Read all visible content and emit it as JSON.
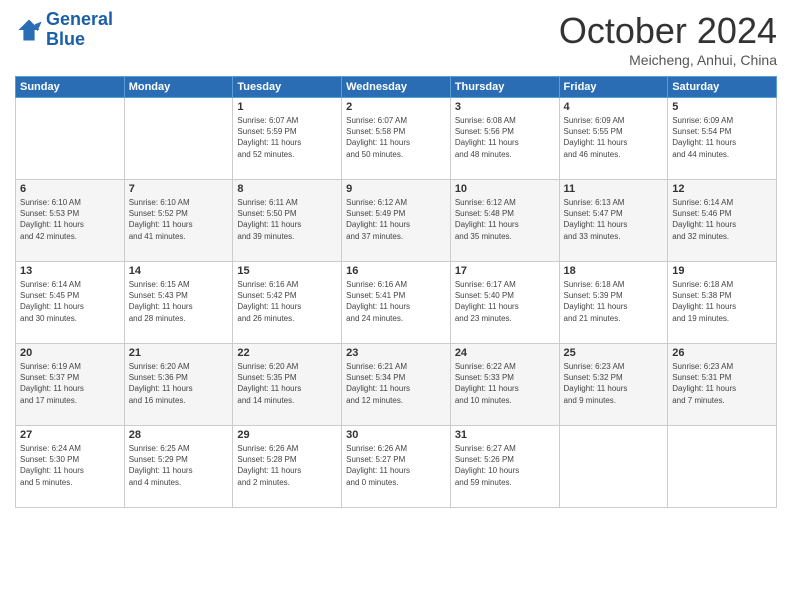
{
  "logo": {
    "line1": "General",
    "line2": "Blue"
  },
  "header": {
    "month": "October 2024",
    "location": "Meicheng, Anhui, China"
  },
  "weekdays": [
    "Sunday",
    "Monday",
    "Tuesday",
    "Wednesday",
    "Thursday",
    "Friday",
    "Saturday"
  ],
  "weeks": [
    [
      {
        "day": "",
        "info": ""
      },
      {
        "day": "",
        "info": ""
      },
      {
        "day": "1",
        "info": "Sunrise: 6:07 AM\nSunset: 5:59 PM\nDaylight: 11 hours\nand 52 minutes."
      },
      {
        "day": "2",
        "info": "Sunrise: 6:07 AM\nSunset: 5:58 PM\nDaylight: 11 hours\nand 50 minutes."
      },
      {
        "day": "3",
        "info": "Sunrise: 6:08 AM\nSunset: 5:56 PM\nDaylight: 11 hours\nand 48 minutes."
      },
      {
        "day": "4",
        "info": "Sunrise: 6:09 AM\nSunset: 5:55 PM\nDaylight: 11 hours\nand 46 minutes."
      },
      {
        "day": "5",
        "info": "Sunrise: 6:09 AM\nSunset: 5:54 PM\nDaylight: 11 hours\nand 44 minutes."
      }
    ],
    [
      {
        "day": "6",
        "info": "Sunrise: 6:10 AM\nSunset: 5:53 PM\nDaylight: 11 hours\nand 42 minutes."
      },
      {
        "day": "7",
        "info": "Sunrise: 6:10 AM\nSunset: 5:52 PM\nDaylight: 11 hours\nand 41 minutes."
      },
      {
        "day": "8",
        "info": "Sunrise: 6:11 AM\nSunset: 5:50 PM\nDaylight: 11 hours\nand 39 minutes."
      },
      {
        "day": "9",
        "info": "Sunrise: 6:12 AM\nSunset: 5:49 PM\nDaylight: 11 hours\nand 37 minutes."
      },
      {
        "day": "10",
        "info": "Sunrise: 6:12 AM\nSunset: 5:48 PM\nDaylight: 11 hours\nand 35 minutes."
      },
      {
        "day": "11",
        "info": "Sunrise: 6:13 AM\nSunset: 5:47 PM\nDaylight: 11 hours\nand 33 minutes."
      },
      {
        "day": "12",
        "info": "Sunrise: 6:14 AM\nSunset: 5:46 PM\nDaylight: 11 hours\nand 32 minutes."
      }
    ],
    [
      {
        "day": "13",
        "info": "Sunrise: 6:14 AM\nSunset: 5:45 PM\nDaylight: 11 hours\nand 30 minutes."
      },
      {
        "day": "14",
        "info": "Sunrise: 6:15 AM\nSunset: 5:43 PM\nDaylight: 11 hours\nand 28 minutes."
      },
      {
        "day": "15",
        "info": "Sunrise: 6:16 AM\nSunset: 5:42 PM\nDaylight: 11 hours\nand 26 minutes."
      },
      {
        "day": "16",
        "info": "Sunrise: 6:16 AM\nSunset: 5:41 PM\nDaylight: 11 hours\nand 24 minutes."
      },
      {
        "day": "17",
        "info": "Sunrise: 6:17 AM\nSunset: 5:40 PM\nDaylight: 11 hours\nand 23 minutes."
      },
      {
        "day": "18",
        "info": "Sunrise: 6:18 AM\nSunset: 5:39 PM\nDaylight: 11 hours\nand 21 minutes."
      },
      {
        "day": "19",
        "info": "Sunrise: 6:18 AM\nSunset: 5:38 PM\nDaylight: 11 hours\nand 19 minutes."
      }
    ],
    [
      {
        "day": "20",
        "info": "Sunrise: 6:19 AM\nSunset: 5:37 PM\nDaylight: 11 hours\nand 17 minutes."
      },
      {
        "day": "21",
        "info": "Sunrise: 6:20 AM\nSunset: 5:36 PM\nDaylight: 11 hours\nand 16 minutes."
      },
      {
        "day": "22",
        "info": "Sunrise: 6:20 AM\nSunset: 5:35 PM\nDaylight: 11 hours\nand 14 minutes."
      },
      {
        "day": "23",
        "info": "Sunrise: 6:21 AM\nSunset: 5:34 PM\nDaylight: 11 hours\nand 12 minutes."
      },
      {
        "day": "24",
        "info": "Sunrise: 6:22 AM\nSunset: 5:33 PM\nDaylight: 11 hours\nand 10 minutes."
      },
      {
        "day": "25",
        "info": "Sunrise: 6:23 AM\nSunset: 5:32 PM\nDaylight: 11 hours\nand 9 minutes."
      },
      {
        "day": "26",
        "info": "Sunrise: 6:23 AM\nSunset: 5:31 PM\nDaylight: 11 hours\nand 7 minutes."
      }
    ],
    [
      {
        "day": "27",
        "info": "Sunrise: 6:24 AM\nSunset: 5:30 PM\nDaylight: 11 hours\nand 5 minutes."
      },
      {
        "day": "28",
        "info": "Sunrise: 6:25 AM\nSunset: 5:29 PM\nDaylight: 11 hours\nand 4 minutes."
      },
      {
        "day": "29",
        "info": "Sunrise: 6:26 AM\nSunset: 5:28 PM\nDaylight: 11 hours\nand 2 minutes."
      },
      {
        "day": "30",
        "info": "Sunrise: 6:26 AM\nSunset: 5:27 PM\nDaylight: 11 hours\nand 0 minutes."
      },
      {
        "day": "31",
        "info": "Sunrise: 6:27 AM\nSunset: 5:26 PM\nDaylight: 10 hours\nand 59 minutes."
      },
      {
        "day": "",
        "info": ""
      },
      {
        "day": "",
        "info": ""
      }
    ]
  ]
}
